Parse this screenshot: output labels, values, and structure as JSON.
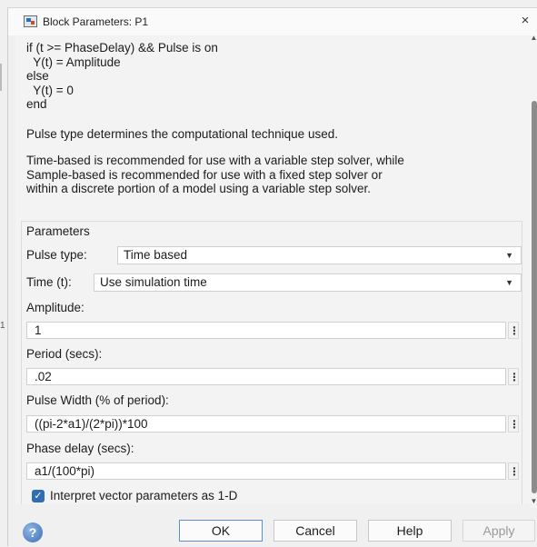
{
  "window": {
    "title": "Block Parameters: P1",
    "close_glyph": "×"
  },
  "description": {
    "code_lines": [
      "if (t >= PhaseDelay) && Pulse is on",
      "  Y(t) = Amplitude",
      "else",
      "  Y(t) = 0",
      "end"
    ],
    "note_pulse_type": "Pulse type determines the computational technique used.",
    "note_recommendation_lines": [
      "Time-based is recommended for use with a variable step solver, while",
      "Sample-based is recommended for use with a fixed step solver or",
      "within a discrete portion of a model using a variable step solver."
    ]
  },
  "parameters": {
    "group_title": "Parameters",
    "pulse_type": {
      "label": "Pulse type:",
      "value": "Time based"
    },
    "time": {
      "label": "Time (t):",
      "value": "Use simulation time"
    },
    "amplitude": {
      "label": "Amplitude:",
      "value": "1"
    },
    "period": {
      "label": "Period (secs):",
      "value": ".02"
    },
    "pulse_width": {
      "label": "Pulse Width (% of period):",
      "value": "((pi-2*a1)/(2*pi))*100"
    },
    "phase_delay": {
      "label": "Phase delay (secs):",
      "value": "a1/(100*pi)"
    },
    "interpret_vector": {
      "label": "Interpret vector parameters as 1-D",
      "checked": true
    }
  },
  "buttons": {
    "ok": "OK",
    "cancel": "Cancel",
    "help": "Help",
    "apply": "Apply"
  },
  "icons": {
    "app": "block-parameters-icon",
    "help": "help-question-icon",
    "dropdown": "chevron-down-icon",
    "field_menu": "kebab-menu-icon"
  },
  "colors": {
    "checkbox": "#2f6db5",
    "primary_border": "#5a8fd0",
    "scroll_thumb": "#8c8c8c"
  },
  "edge_mark": "1"
}
